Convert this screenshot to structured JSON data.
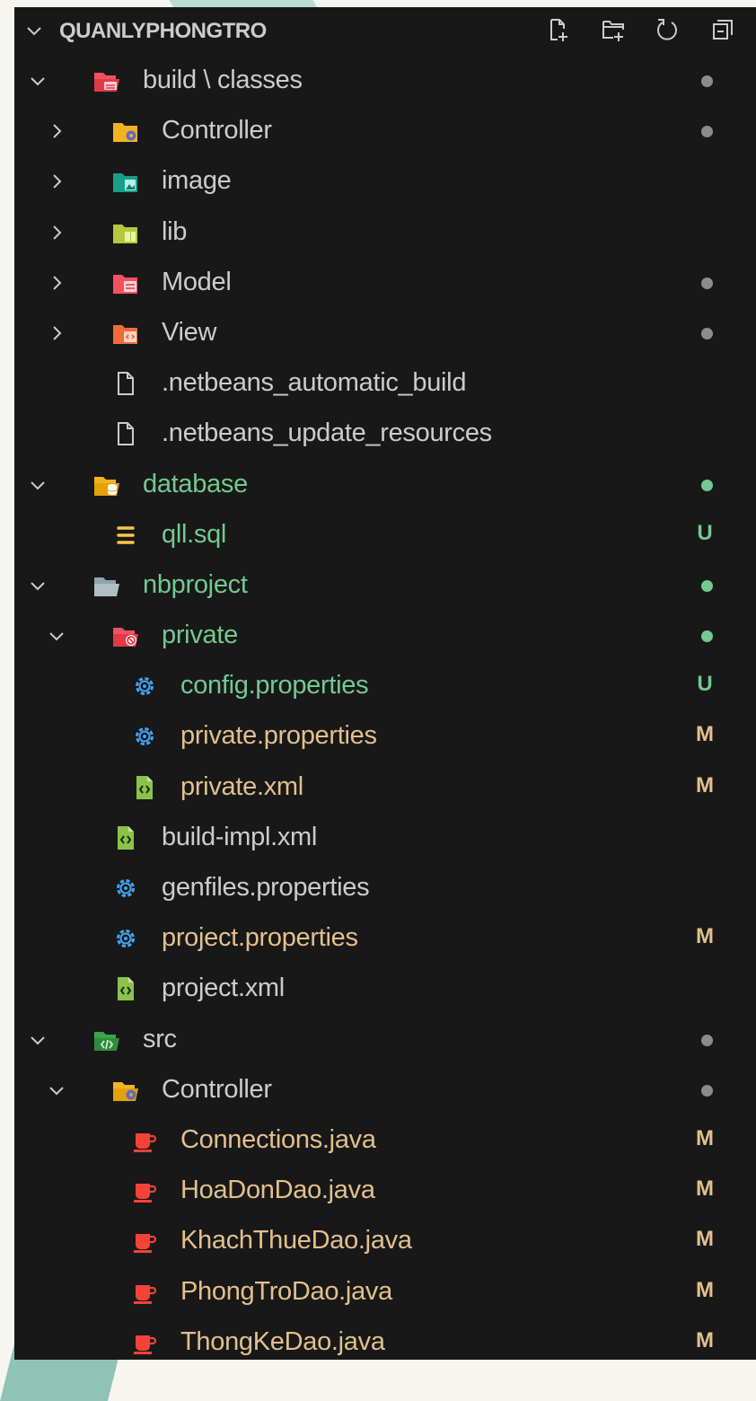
{
  "explorer": {
    "project_name": "QUANLYPHONGTRO"
  },
  "colors": {
    "default_text": "#cccccc",
    "untracked": "#73c991",
    "modified": "#e2c08d",
    "dot_gray": "#8c8c8c",
    "dot_green": "#73c991"
  },
  "tree": [
    {
      "depth": 0,
      "twisty": "expanded",
      "icon": "folder-build-open-icon",
      "label": "build \\ classes",
      "tone": "default",
      "dot": "gray",
      "badge": ""
    },
    {
      "depth": 1,
      "twisty": "collapsed",
      "icon": "folder-controller-icon",
      "label": "Controller",
      "tone": "default",
      "dot": "gray",
      "badge": ""
    },
    {
      "depth": 1,
      "twisty": "collapsed",
      "icon": "folder-image-icon",
      "label": "image",
      "tone": "default",
      "dot": "",
      "badge": ""
    },
    {
      "depth": 1,
      "twisty": "collapsed",
      "icon": "folder-lib-icon",
      "label": "lib",
      "tone": "default",
      "dot": "",
      "badge": ""
    },
    {
      "depth": 1,
      "twisty": "collapsed",
      "icon": "folder-model-icon",
      "label": "Model",
      "tone": "default",
      "dot": "gray",
      "badge": ""
    },
    {
      "depth": 1,
      "twisty": "collapsed",
      "icon": "folder-view-icon",
      "label": "View",
      "tone": "default",
      "dot": "gray",
      "badge": ""
    },
    {
      "depth": 1,
      "twisty": "none",
      "icon": "file-icon",
      "label": ".netbeans_automatic_build",
      "tone": "default",
      "dot": "",
      "badge": ""
    },
    {
      "depth": 1,
      "twisty": "none",
      "icon": "file-icon",
      "label": ".netbeans_update_resources",
      "tone": "default",
      "dot": "",
      "badge": ""
    },
    {
      "depth": 0,
      "twisty": "expanded",
      "icon": "folder-database-open-icon",
      "label": "database",
      "tone": "untracked",
      "dot": "green",
      "badge": ""
    },
    {
      "depth": 1,
      "twisty": "none",
      "icon": "database-file-icon",
      "label": "qll.sql",
      "tone": "untracked",
      "dot": "",
      "badge": "U"
    },
    {
      "depth": 0,
      "twisty": "expanded",
      "icon": "folder-open-icon",
      "label": "nbproject",
      "tone": "untracked",
      "dot": "green",
      "badge": ""
    },
    {
      "depth": 1,
      "twisty": "expanded",
      "icon": "folder-private-open-icon",
      "label": "private",
      "tone": "untracked",
      "dot": "green",
      "badge": ""
    },
    {
      "depth": 2,
      "twisty": "none",
      "icon": "settings-gear-icon",
      "label": "config.properties",
      "tone": "untracked",
      "dot": "",
      "badge": "U"
    },
    {
      "depth": 2,
      "twisty": "none",
      "icon": "settings-gear-icon",
      "label": "private.properties",
      "tone": "modified",
      "dot": "",
      "badge": "M"
    },
    {
      "depth": 2,
      "twisty": "none",
      "icon": "xml-file-icon",
      "label": "private.xml",
      "tone": "modified",
      "dot": "",
      "badge": "M"
    },
    {
      "depth": 1,
      "twisty": "none",
      "icon": "xml-file-icon",
      "label": "build-impl.xml",
      "tone": "default",
      "dot": "",
      "badge": ""
    },
    {
      "depth": 1,
      "twisty": "none",
      "icon": "settings-gear-icon",
      "label": "genfiles.properties",
      "tone": "default",
      "dot": "",
      "badge": ""
    },
    {
      "depth": 1,
      "twisty": "none",
      "icon": "settings-gear-icon",
      "label": "project.properties",
      "tone": "modified",
      "dot": "",
      "badge": "M"
    },
    {
      "depth": 1,
      "twisty": "none",
      "icon": "xml-file-icon",
      "label": "project.xml",
      "tone": "default",
      "dot": "",
      "badge": ""
    },
    {
      "depth": 0,
      "twisty": "expanded",
      "icon": "folder-src-open-icon",
      "label": "src",
      "tone": "default",
      "dot": "gray",
      "badge": ""
    },
    {
      "depth": 1,
      "twisty": "expanded",
      "icon": "folder-controller-open-icon",
      "label": "Controller",
      "tone": "default",
      "dot": "gray",
      "badge": ""
    },
    {
      "depth": 2,
      "twisty": "none",
      "icon": "java-file-icon",
      "label": "Connections.java",
      "tone": "modified",
      "dot": "",
      "badge": "M"
    },
    {
      "depth": 2,
      "twisty": "none",
      "icon": "java-file-icon",
      "label": "HoaDonDao.java",
      "tone": "modified",
      "dot": "",
      "badge": "M"
    },
    {
      "depth": 2,
      "twisty": "none",
      "icon": "java-file-icon",
      "label": "KhachThueDao.java",
      "tone": "modified",
      "dot": "",
      "badge": "M"
    },
    {
      "depth": 2,
      "twisty": "none",
      "icon": "java-file-icon",
      "label": "PhongTroDao.java",
      "tone": "modified",
      "dot": "",
      "badge": "M"
    },
    {
      "depth": 2,
      "twisty": "none",
      "icon": "java-file-icon",
      "label": "ThongKeDao.java",
      "tone": "modified",
      "dot": "",
      "badge": "M"
    }
  ]
}
